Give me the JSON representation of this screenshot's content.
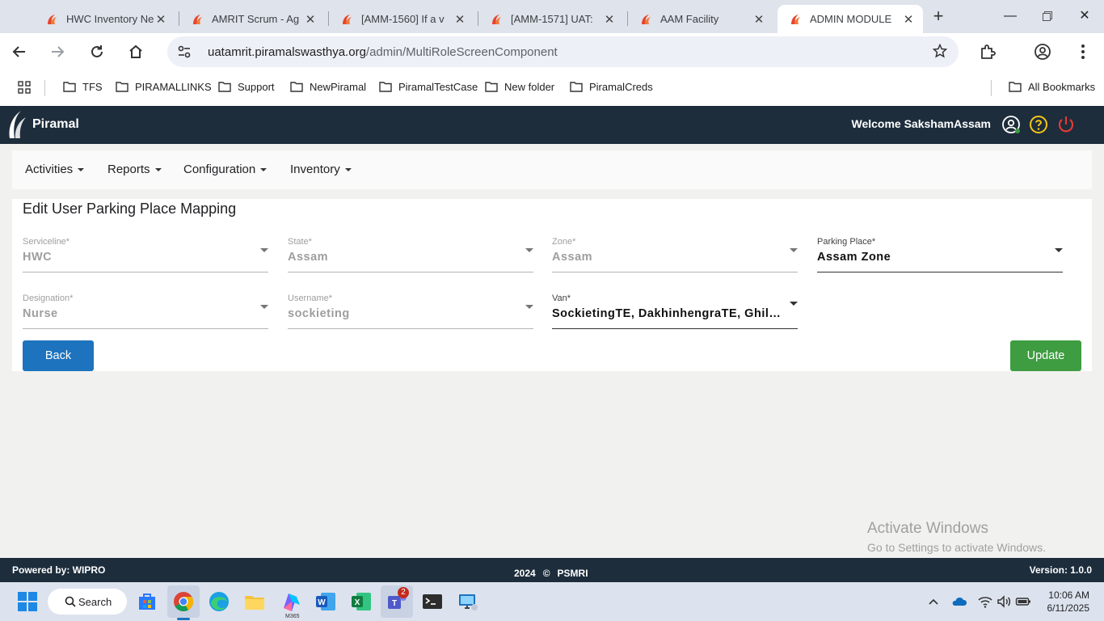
{
  "browser": {
    "tabs": [
      {
        "title": "HWC Inventory Ne",
        "active": false
      },
      {
        "title": "AMRIT Scrum - Ag",
        "active": false
      },
      {
        "title": "[AMM-1560] If a v",
        "active": false
      },
      {
        "title": "[AMM-1571] UAT:",
        "active": false
      },
      {
        "title": "AAM Facility",
        "active": false
      },
      {
        "title": "ADMIN MODULE",
        "active": true
      }
    ],
    "url_host": "uatamrit.piramalswasthya.org",
    "url_path": "/admin/MultiRoleScreenComponent",
    "bookmarks": [
      "TFS",
      "PIRAMALLINKS",
      "Support",
      "NewPiramal",
      "PiramalTestCase",
      "New folder",
      "PiramalCreds"
    ],
    "all_bookmarks_label": "All Bookmarks"
  },
  "app": {
    "logo_text": "Piramal",
    "welcome_text": "Welcome SakshamAssam",
    "menu": [
      "Activities",
      "Reports",
      "Configuration",
      "Inventory"
    ],
    "form": {
      "title": "Edit User Parking Place Mapping",
      "fields": [
        {
          "label": "Serviceline*",
          "value": "HWC",
          "enabled": false
        },
        {
          "label": "State*",
          "value": "Assam",
          "enabled": false
        },
        {
          "label": "Zone*",
          "value": "Assam",
          "enabled": false
        },
        {
          "label": "Parking Place*",
          "value": "Assam Zone",
          "enabled": true
        },
        {
          "label": "Designation*",
          "value": "Nurse",
          "enabled": false
        },
        {
          "label": "Username*",
          "value": "sockieting",
          "enabled": false
        },
        {
          "label": "Van*",
          "value": "SockietingTE, DakhinhengraTE, Ghil…",
          "enabled": true
        }
      ],
      "back_label": "Back",
      "update_label": "Update",
      "colors": {
        "back": "#1e73be",
        "update": "#3e9c41"
      }
    },
    "footer": {
      "powered_by": "Powered by: WIPRO",
      "year": "2024",
      "copyright_symbol": "©",
      "org": "PSMRI",
      "version": "Version: 1.0.0"
    },
    "colors": {
      "header": "#1d2d3c",
      "help_icon": "#f5c518",
      "power_icon": "#e53935"
    }
  },
  "watermark": {
    "line1": "Activate Windows",
    "line2": "Go to Settings to activate Windows."
  },
  "taskbar": {
    "search_label": "Search",
    "teams_badge": "2",
    "m365_label": "M365",
    "time": "10:06 AM",
    "date": "6/11/2025"
  }
}
